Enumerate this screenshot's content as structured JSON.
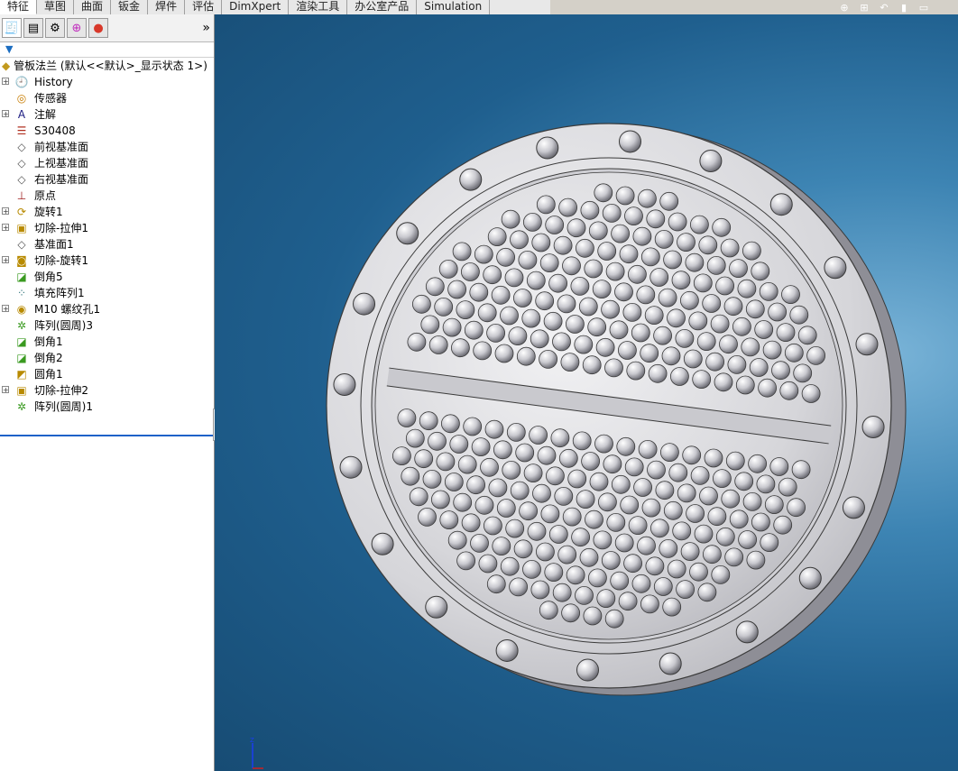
{
  "command_tabs": [
    "特征",
    "草图",
    "曲面",
    "钣金",
    "焊件",
    "评估",
    "DimXpert",
    "渲染工具",
    "办公室产品",
    "Simulation"
  ],
  "active_tab_index": 0,
  "panel_tab_icons": [
    "feature-manager-icon",
    "property-manager-icon",
    "configuration-manager-icon",
    "dimxpert-manager-icon",
    "display-manager-icon"
  ],
  "panel_more_glyph": "»",
  "tree": {
    "root_label": "管板法兰 (默认<<默认>_显示状态 1>)",
    "items": [
      {
        "label": "History",
        "icon": "history-icon",
        "expandable": true
      },
      {
        "label": "传感器",
        "icon": "sensor-icon",
        "expandable": false
      },
      {
        "label": "注解",
        "icon": "annotation-icon",
        "expandable": true
      },
      {
        "label": "S30408",
        "icon": "material-icon",
        "expandable": false
      },
      {
        "label": "前视基准面",
        "icon": "plane-icon",
        "expandable": false
      },
      {
        "label": "上视基准面",
        "icon": "plane-icon",
        "expandable": false
      },
      {
        "label": "右视基准面",
        "icon": "plane-icon",
        "expandable": false
      },
      {
        "label": "原点",
        "icon": "origin-icon",
        "expandable": false
      },
      {
        "label": "旋转1",
        "icon": "revolve-icon",
        "expandable": true
      },
      {
        "label": "切除-拉伸1",
        "icon": "cut-extrude-icon",
        "expandable": true
      },
      {
        "label": "基准面1",
        "icon": "plane-icon",
        "expandable": false
      },
      {
        "label": "切除-旋转1",
        "icon": "cut-revolve-icon",
        "expandable": true
      },
      {
        "label": "倒角5",
        "icon": "chamfer-icon",
        "expandable": false
      },
      {
        "label": "填充阵列1",
        "icon": "fill-pattern-icon",
        "expandable": false
      },
      {
        "label": "M10 螺纹孔1",
        "icon": "hole-wizard-icon",
        "expandable": true
      },
      {
        "label": "阵列(圆周)3",
        "icon": "circular-pattern-icon",
        "expandable": false
      },
      {
        "label": "倒角1",
        "icon": "chamfer-icon",
        "expandable": false
      },
      {
        "label": "倒角2",
        "icon": "chamfer-icon",
        "expandable": false
      },
      {
        "label": "圆角1",
        "icon": "fillet-icon",
        "expandable": false
      },
      {
        "label": "切除-拉伸2",
        "icon": "cut-extrude-icon",
        "expandable": true
      },
      {
        "label": "阵列(圆周)1",
        "icon": "circular-pattern-icon",
        "expandable": false
      }
    ]
  },
  "hud_icons": [
    "zoom-to-fit-icon",
    "zoom-area-icon",
    "previous-view-icon",
    "section-view-icon",
    "view-orientation-icon"
  ],
  "model": {
    "name": "tube-sheet-flange",
    "bolt_hole_count": 20,
    "colors": {
      "metal": "#d6d6da",
      "metal_dark": "#8e8e96",
      "edge": "#3a3a3a",
      "hole": "#6e6e76",
      "bg_dark": "#174c74",
      "bg_light": "#7ab4d8"
    }
  },
  "triad_axis": "Z"
}
